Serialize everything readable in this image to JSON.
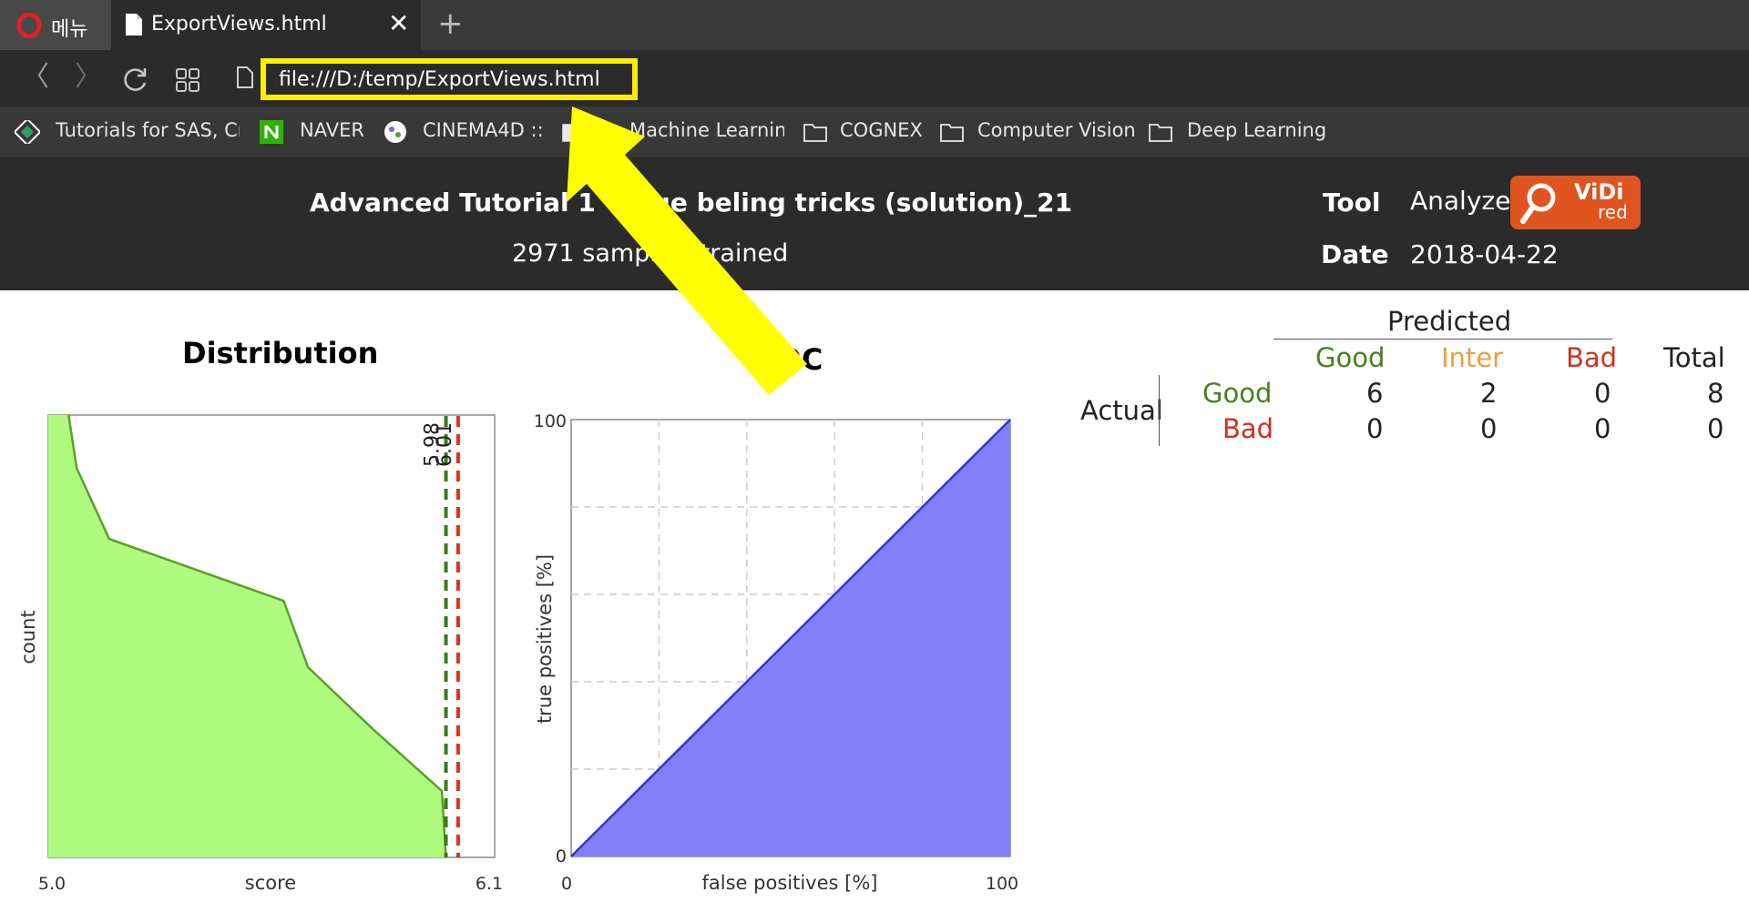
{
  "browser": {
    "menu_tab_label": "메뉴",
    "active_tab_title": "ExportViews.html",
    "new_tab_glyph": "+",
    "close_glyph": "✕",
    "back_glyph": "〈",
    "forward_glyph": "〉",
    "url": "file:///D:/temp/ExportViews.html",
    "url_highlight_color": "#ffee00",
    "bookmarks": [
      {
        "label": "Tutorials for SAS, Cr",
        "icon": "site-icon"
      },
      {
        "label": "NAVER",
        "icon": "naver-icon"
      },
      {
        "label": "CINEMA4D ::",
        "icon": "site-icon"
      },
      {
        "label": "Machine Learnin",
        "icon": "folder-icon"
      },
      {
        "label": "COGNEX",
        "icon": "folder-icon"
      },
      {
        "label": "Computer Vision",
        "icon": "folder-icon"
      },
      {
        "label": "Deep Learning",
        "icon": "folder-icon"
      }
    ]
  },
  "report": {
    "title": "Advanced Tutorial 1 - Blue beling tricks (solution)_21",
    "subtitle": "2971 samples, trained",
    "tool_label": "Tool",
    "tool_value": "Analyze",
    "date_label": "Date",
    "date_value": "2018-04-22",
    "logo_text_main": "ViDi",
    "logo_text_sub": "red"
  },
  "distribution": {
    "title": "Distribution",
    "xlabel": "score",
    "ylabel": "count",
    "x_min_label": "5.0",
    "x_max_label": "6.1",
    "threshold_good_label": "5.98",
    "threshold_bad_label": "6.01"
  },
  "roc": {
    "title": "ROC",
    "xlabel": "false positives [%]",
    "ylabel": "true positives [%]",
    "x_min_label": "0",
    "x_max_label": "100",
    "y_min_label": "0",
    "y_max_label": "100"
  },
  "chart_data": [
    {
      "type": "area",
      "title": "Distribution",
      "xlabel": "score",
      "ylabel": "count",
      "xlim": [
        5.0,
        6.1
      ],
      "x": [
        5.05,
        5.07,
        5.15,
        5.58,
        5.64,
        5.8,
        5.97,
        5.98
      ],
      "y": [
        1.0,
        0.88,
        0.72,
        0.58,
        0.43,
        0.29,
        0.15,
        0.0
      ],
      "thresholds": [
        {
          "value": 5.98,
          "color": "#3a7a1a"
        },
        {
          "value": 6.01,
          "color": "#e03020"
        }
      ],
      "fill_color": "#aefb7f",
      "line_color": "#5aa02a"
    },
    {
      "type": "area",
      "title": "ROC",
      "xlabel": "false positives [%]",
      "ylabel": "true positives [%]",
      "xlim": [
        0,
        100
      ],
      "ylim": [
        0,
        100
      ],
      "x": [
        0,
        100
      ],
      "y": [
        0,
        100
      ],
      "fill_color": "#8080f8",
      "line_color": "#3333dd",
      "grid": true
    }
  ],
  "confusion_matrix": {
    "predicted_label": "Predicted",
    "actual_label": "Actual",
    "col_headers": [
      "Good",
      "Inter",
      "Bad",
      "Total"
    ],
    "rows": [
      {
        "label": "Good",
        "values": [
          "6",
          "2",
          "0",
          "8"
        ]
      },
      {
        "label": "Bad",
        "values": [
          "0",
          "0",
          "0",
          "0"
        ]
      }
    ]
  },
  "colors": {
    "good": "#4a7f1f",
    "inter": "#e8a040",
    "bad": "#d03020",
    "annotation_arrow": "#ffff00"
  }
}
